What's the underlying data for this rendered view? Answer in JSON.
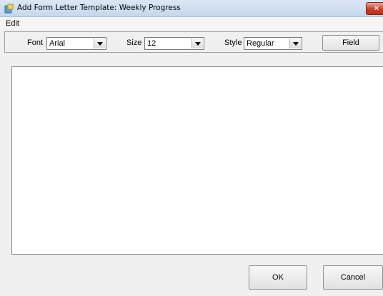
{
  "window": {
    "title": "Add Form Letter Template: Weekly Progress",
    "close_glyph": "×"
  },
  "menu": {
    "items": [
      {
        "label": "Edit"
      }
    ]
  },
  "toolbar": {
    "font_label": "Font",
    "font_value": "Arial",
    "size_label": "Size",
    "size_value": "12",
    "style_label": "Style",
    "style_value": "Regular",
    "field_button": "Field"
  },
  "editor": {
    "content": ""
  },
  "footer": {
    "ok_button": "OK",
    "cancel_button": "Cancel"
  },
  "colors": {
    "titlebar": "#c6d7ec",
    "close_button": "#c7402a",
    "window_bg": "#f0f0f0"
  },
  "icons": {
    "app": "app-icon",
    "dropdown": "chevron-down-icon"
  }
}
